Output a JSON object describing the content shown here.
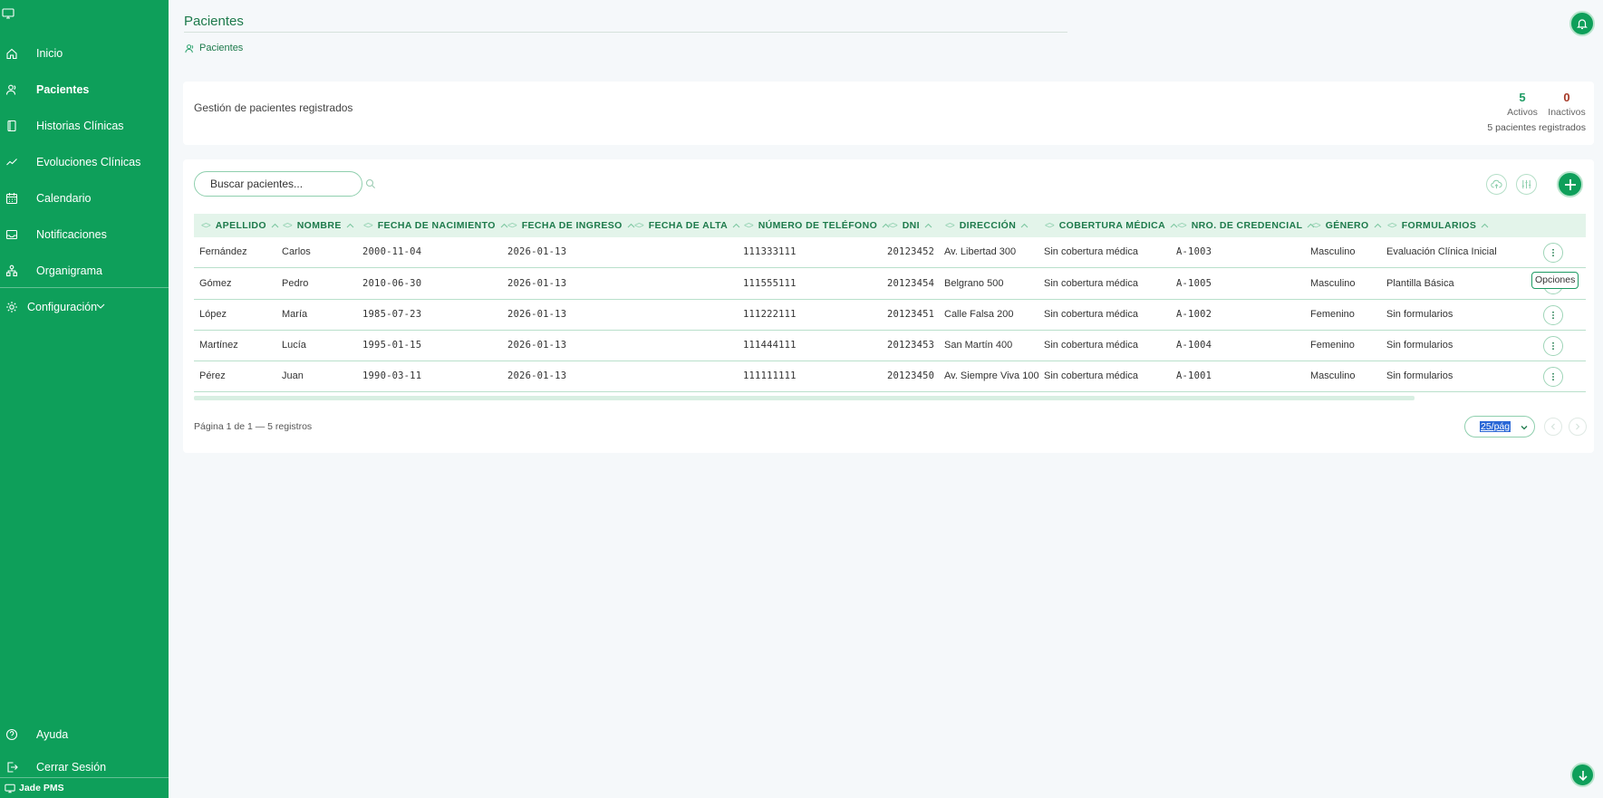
{
  "sidebar": {
    "items": [
      {
        "label": "Inicio",
        "icon": "home-icon"
      },
      {
        "label": "Pacientes",
        "icon": "users-icon"
      },
      {
        "label": "Historias Clínicas",
        "icon": "book-icon"
      },
      {
        "label": "Evoluciones Clínicas",
        "icon": "trend-icon"
      },
      {
        "label": "Calendario",
        "icon": "calendar-icon"
      },
      {
        "label": "Notificaciones",
        "icon": "inbox-icon"
      },
      {
        "label": "Organigrama",
        "icon": "org-icon"
      }
    ],
    "config_label": "Configuración",
    "bottom_items": [
      {
        "label": "Ayuda",
        "icon": "help-icon"
      },
      {
        "label": "Cerrar Sesión",
        "icon": "logout-icon"
      }
    ],
    "app_name": "Jade PMS"
  },
  "header": {
    "title": "Pacientes",
    "breadcrumb": "Pacientes"
  },
  "summary": {
    "description": "Gestión de pacientes registrados",
    "active_count": "5",
    "active_label": "Activos",
    "inactive_count": "0",
    "inactive_label": "Inactivos",
    "registered": "5 pacientes registrados"
  },
  "search": {
    "placeholder": "Buscar pacientes..."
  },
  "table": {
    "columns": [
      "APELLIDO",
      "NOMBRE",
      "FECHA DE NACIMIENTO",
      "FECHA DE INGRESO",
      "FECHA DE ALTA",
      "NÚMERO DE TELÉFONO",
      "DNI",
      "DIRECCIÓN",
      "COBERTURA MÉDICA",
      "NRO. DE CREDENCIAL",
      "GÉNERO",
      "FORMULARIOS"
    ],
    "rows": [
      [
        "Fernández",
        "Carlos",
        "2000-11-04",
        "2026-01-13",
        "",
        "111333111",
        "20123452",
        "Av. Libertad 300",
        "Sin cobertura médica",
        "A-1003",
        "Masculino",
        "Evaluación Clínica Inicial"
      ],
      [
        "Gómez",
        "Pedro",
        "2010-06-30",
        "2026-01-13",
        "",
        "111555111",
        "20123454",
        "Belgrano 500",
        "Sin cobertura médica",
        "A-1005",
        "Masculino",
        "Plantilla Básica"
      ],
      [
        "López",
        "María",
        "1985-07-23",
        "2026-01-13",
        "",
        "111222111",
        "20123451",
        "Calle Falsa 200",
        "Sin cobertura médica",
        "A-1002",
        "Femenino",
        "Sin formularios"
      ],
      [
        "Martínez",
        "Lucía",
        "1995-01-15",
        "2026-01-13",
        "",
        "111444111",
        "20123453",
        "San Martín 400",
        "Sin cobertura médica",
        "A-1004",
        "Femenino",
        "Sin formularios"
      ],
      [
        "Pérez",
        "Juan",
        "1990-03-11",
        "2026-01-13",
        "",
        "111111111",
        "20123450",
        "Av. Siempre Viva 100",
        "Sin cobertura médica",
        "A-1001",
        "Masculino",
        "Sin formularios"
      ]
    ],
    "options_tooltip": "Opciones"
  },
  "pagination": {
    "info": "Página 1 de 1 — 5 registros",
    "per_page": "25/pág"
  },
  "colors": {
    "brand": "#0e9f5a",
    "accent_text": "#1d7a4b",
    "inactive": "#a63a28"
  }
}
